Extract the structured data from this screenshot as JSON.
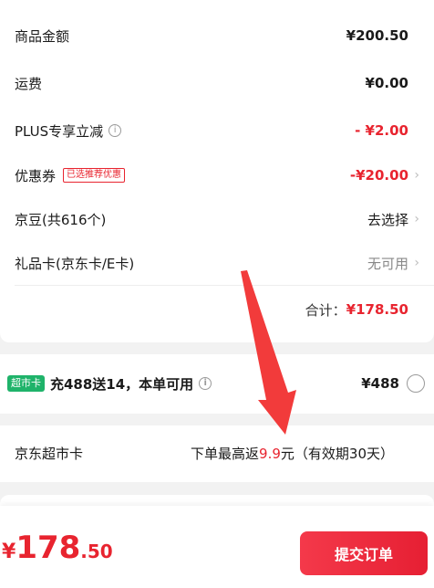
{
  "summary": {
    "product_amount_label": "商品金额",
    "product_amount_value": "¥200.50",
    "shipping_label": "运费",
    "shipping_value": "¥0.00",
    "plus_label": "PLUS专享立减",
    "plus_value": "- ¥2.00",
    "coupon_label": "优惠券",
    "coupon_tag": "已选推荐优惠",
    "coupon_value": "-¥20.00",
    "jdbean_label": "京豆(共616个)",
    "jdbean_value": "去选择",
    "giftcard_label": "礼品卡(京东卡/E卡)",
    "giftcard_value": "无可用",
    "total_label": "合计：",
    "total_value": "¥178.50"
  },
  "supercard": {
    "badge": "超市卡",
    "text": "充488送14，本单可用",
    "price": "¥488"
  },
  "jd_supercard": {
    "label": "京东超市卡",
    "text_before": "下单最高返",
    "text_highlight": "9.9",
    "text_after": "元（有效期30天）"
  },
  "bottom": {
    "currency": "¥",
    "price_int": "178",
    "price_dec": ".50",
    "submit_label": "提交订单"
  },
  "icons": {
    "info": "info-icon",
    "chevron": "chevron-right-icon",
    "radio": "radio-icon",
    "arrow": "annotation-arrow"
  },
  "colors": {
    "accent_red": "#e8242f",
    "badge_green": "#1fb36a",
    "background": "#f2f2f2"
  }
}
